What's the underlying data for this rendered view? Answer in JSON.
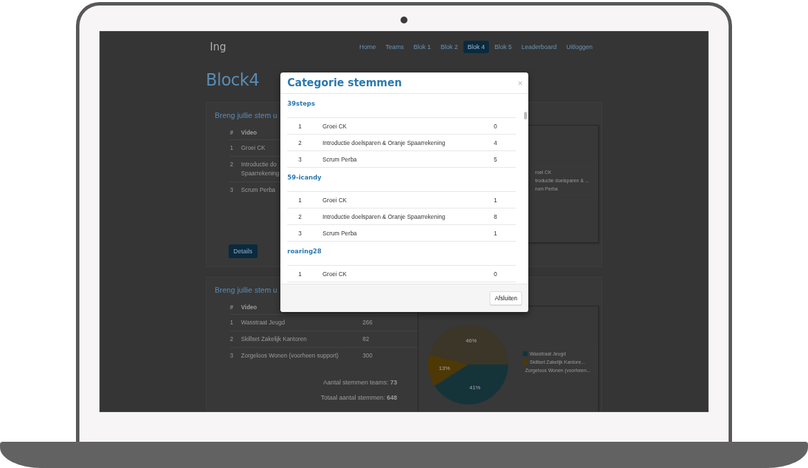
{
  "navbar": {
    "brand": "Ing",
    "links": [
      {
        "label": "Home",
        "selected": false
      },
      {
        "label": "Teams",
        "selected": false
      },
      {
        "label": "Blok 1",
        "selected": false
      },
      {
        "label": "Blok 2",
        "selected": false
      },
      {
        "label": "Blok 4",
        "selected": true
      },
      {
        "label": "Blok 5",
        "selected": false
      },
      {
        "label": "Leaderboard",
        "selected": false
      },
      {
        "label": "Uitloggen",
        "selected": false
      }
    ]
  },
  "heading": "Block4",
  "panels": [
    {
      "title": "Breng jullie stem u",
      "columns": [
        "#",
        "Video"
      ],
      "rows": [
        [
          "1",
          "Groei CK"
        ],
        [
          "2",
          "Introductie do\nSpaarrekening"
        ],
        [
          "3",
          "Scrum Perba"
        ]
      ],
      "button": "Details",
      "legend": [
        "roei CK",
        "troductie doelsparen & ...",
        "rum Perba"
      ]
    },
    {
      "title": "Breng jullie stem u",
      "columns": [
        "#",
        "Video"
      ],
      "rows": [
        [
          "1",
          "Wasstraat Jeugd",
          "266"
        ],
        [
          "2",
          "Skillset Zakelijk Kantoren",
          "82"
        ],
        [
          "3",
          "Zorgeloos Wonen (voorheen support)",
          "300"
        ]
      ],
      "summary": [
        "Aantal stemmen teams: **73**",
        "Totaal aantal stemmen: **648**"
      ],
      "chart_data": {
        "type": "pie",
        "categories": [
          "Wasstraat Jeugd",
          "Skillset Zakelijk Kantore...",
          "Zorgeloos Wonen (voorheen..."
        ],
        "values": [
          41,
          13,
          46
        ],
        "colors": [
          "#15343a",
          "#4e3806",
          "#3b3628"
        ],
        "value_labels": [
          "41%",
          "13%",
          "46%"
        ]
      }
    }
  ],
  "modal": {
    "title": "Categorie stemmen",
    "close": "×",
    "groups": [
      {
        "team": "39steps",
        "rows": [
          [
            "1",
            "Groei CK",
            "0"
          ],
          [
            "2",
            "Introductie doelsparen & Oranje Spaarrekening",
            "4"
          ],
          [
            "3",
            "Scrum Perba",
            "5"
          ]
        ]
      },
      {
        "team": "59-icandy",
        "rows": [
          [
            "1",
            "Groei CK",
            "1"
          ],
          [
            "2",
            "Introductie doelsparen & Oranje Spaarrekening",
            "8"
          ],
          [
            "3",
            "Scrum Perba",
            "1"
          ]
        ]
      },
      {
        "team": "roaring28",
        "rows": [
          [
            "1",
            "Groei CK",
            "0"
          ]
        ]
      }
    ],
    "button": "Afsluiten"
  }
}
